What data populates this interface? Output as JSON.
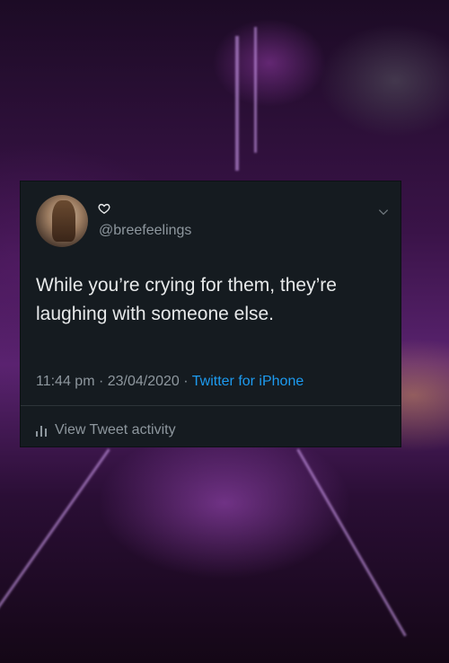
{
  "tweet": {
    "heart_glyph": "♡",
    "handle": "@breefeelings",
    "text": "While you’re crying for them, they’re laughing with someone else.",
    "timestamp": "11:44 pm · 23/04/2020 · ",
    "source": "Twitter for iPhone",
    "activity_label": "View Tweet activity"
  },
  "colors": {
    "card_bg": "#151b20",
    "text": "#e7e9ea",
    "muted": "#8e979e",
    "link": "#1d9bf0"
  }
}
